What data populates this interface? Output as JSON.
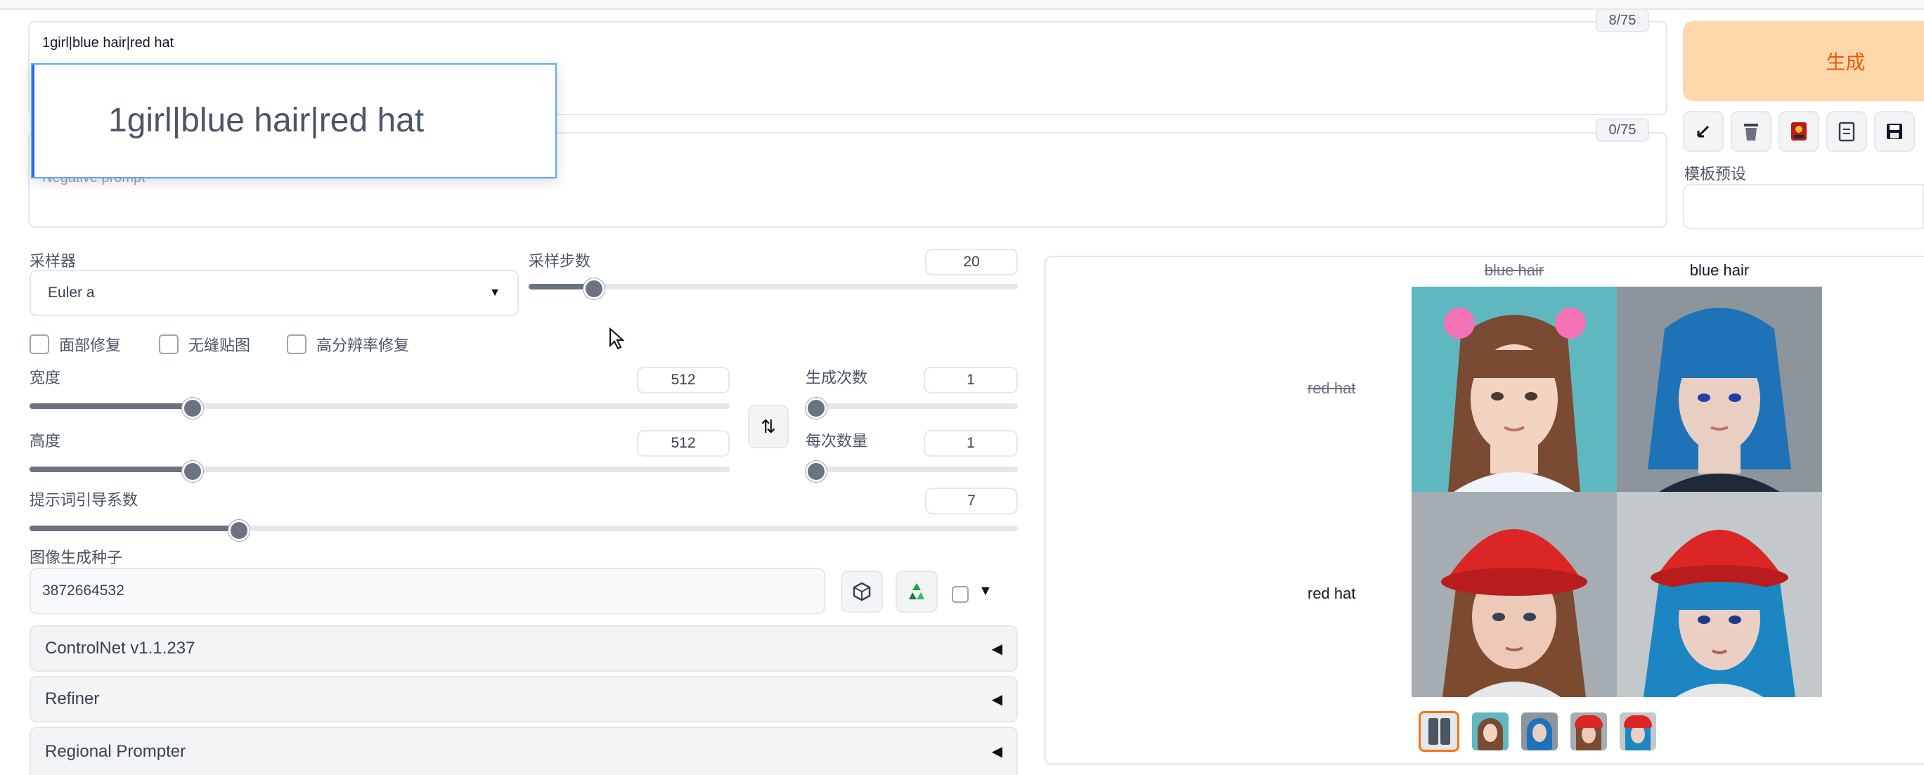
{
  "prompt": {
    "value": "1girl|blue hair|red hat",
    "counter": "8/75"
  },
  "negative": {
    "placeholder": "Negative prompt",
    "counter": "0/75"
  },
  "autocomplete": {
    "text": "1girl|blue hair|red hat"
  },
  "generate": {
    "label": "生成",
    "preset_label": "模板预设"
  },
  "sampler": {
    "label": "采样器",
    "value": "Euler a"
  },
  "steps": {
    "label": "采样步数",
    "value": "20",
    "fraction": 0.13
  },
  "options": {
    "face": "面部修复",
    "tiling": "无缝贴图",
    "hires": "高分辨率修复"
  },
  "width": {
    "label": "宽度",
    "value": "512",
    "fraction": 0.23
  },
  "height": {
    "label": "高度",
    "value": "512",
    "fraction": 0.23
  },
  "batch_count": {
    "label": "生成次数",
    "value": "1",
    "fraction": 0
  },
  "batch_size": {
    "label": "每次数量",
    "value": "1",
    "fraction": 0
  },
  "cfg": {
    "label": "提示词引导系数",
    "value": "7",
    "fraction": 0.21
  },
  "seed": {
    "label": "图像生成种子",
    "value": "3872664532"
  },
  "accordions": {
    "controlnet": "ControlNet v1.1.237",
    "refiner": "Refiner",
    "regional": "Regional Prompter"
  },
  "grid": {
    "col1": "blue hair",
    "col2": "blue hair",
    "row1": "red hat",
    "row2": "red hat"
  },
  "colors": {
    "accent": "#f97316",
    "generate_bg": "#fed7aa",
    "generate_text": "#ea580c",
    "link_blue": "#3b82f6"
  },
  "icons": {
    "swap": "swap-icon",
    "dice": "dice-icon",
    "recycle": "recycle-icon",
    "trash": "trash-icon",
    "save": "save-icon",
    "arrow": "arrow-icon",
    "clipboard": "clipboard-icon",
    "image": "image-icon"
  }
}
